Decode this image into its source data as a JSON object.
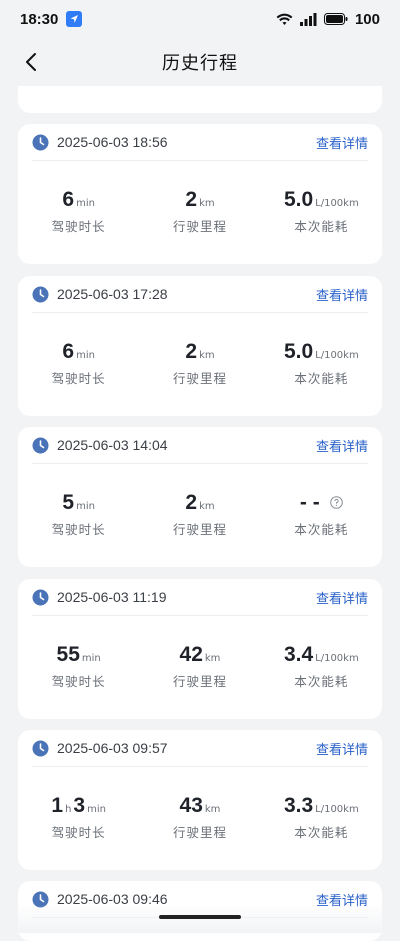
{
  "status": {
    "time": "18:30",
    "battery": "100"
  },
  "nav": {
    "title": "历史行程"
  },
  "labels": {
    "duration": "驾驶时长",
    "distance": "行驶里程",
    "fuel": "本次能耗",
    "detail": "查看详情"
  },
  "units": {
    "min": "min",
    "h": "h",
    "km": "km",
    "fuel": "L/100km"
  },
  "trips": [
    {
      "datetime": "2025-06-03 18:56",
      "duration": "6",
      "distance": "2",
      "fuel": "5.0"
    },
    {
      "datetime": "2025-06-03 17:28",
      "duration": "6",
      "distance": "2",
      "fuel": "5.0"
    },
    {
      "datetime": "2025-06-03 14:04",
      "duration": "5",
      "distance": "2",
      "fuel": "- -"
    },
    {
      "datetime": "2025-06-03 11:19",
      "duration": "55",
      "distance": "42",
      "fuel": "3.4"
    },
    {
      "datetime": "2025-06-03 09:57",
      "duration_h": "1",
      "duration_m": "3",
      "distance": "43",
      "fuel": "3.3"
    },
    {
      "datetime": "2025-06-03 09:46"
    }
  ],
  "colors": {
    "accent": "#2a62c9",
    "clock": "#4a73b8",
    "background": "#f2f3f5"
  }
}
